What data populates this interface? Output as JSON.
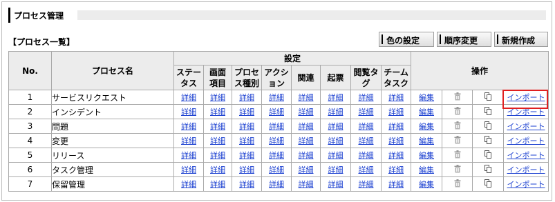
{
  "page": {
    "title": "プロセス管理",
    "list_title": "【プロセス一覧】",
    "buttons": {
      "color": "色の設定",
      "order": "順序変更",
      "new": "新規作成"
    }
  },
  "table": {
    "headers": {
      "no": "No.",
      "name": "プロセス名",
      "settings": "設定",
      "status": [
        "ステー",
        "タス"
      ],
      "screen": [
        "画面",
        "項目"
      ],
      "type": [
        "プロセ",
        "ス種別"
      ],
      "action": [
        "アクシ",
        "ョン"
      ],
      "related": "関連",
      "draft": "起票",
      "viewtag": [
        "閲覧タ",
        "グ"
      ],
      "team": [
        "チーム",
        "タスク"
      ],
      "ops": "操作"
    },
    "detail_label": "詳細",
    "edit_label": "編集",
    "import_label": "インポート",
    "rows": [
      {
        "no": "1",
        "name": "サービスリクエスト"
      },
      {
        "no": "2",
        "name": "インシデント"
      },
      {
        "no": "3",
        "name": "問題"
      },
      {
        "no": "4",
        "name": "変更"
      },
      {
        "no": "5",
        "name": "リリース"
      },
      {
        "no": "6",
        "name": "タスク管理"
      },
      {
        "no": "7",
        "name": "保留管理"
      }
    ]
  },
  "colors": {
    "link": "#1a3fd0",
    "highlight": "#e02020",
    "header_bg": "#ececec"
  },
  "icons": {
    "delete": "trash-icon",
    "copy": "copy-icon"
  }
}
